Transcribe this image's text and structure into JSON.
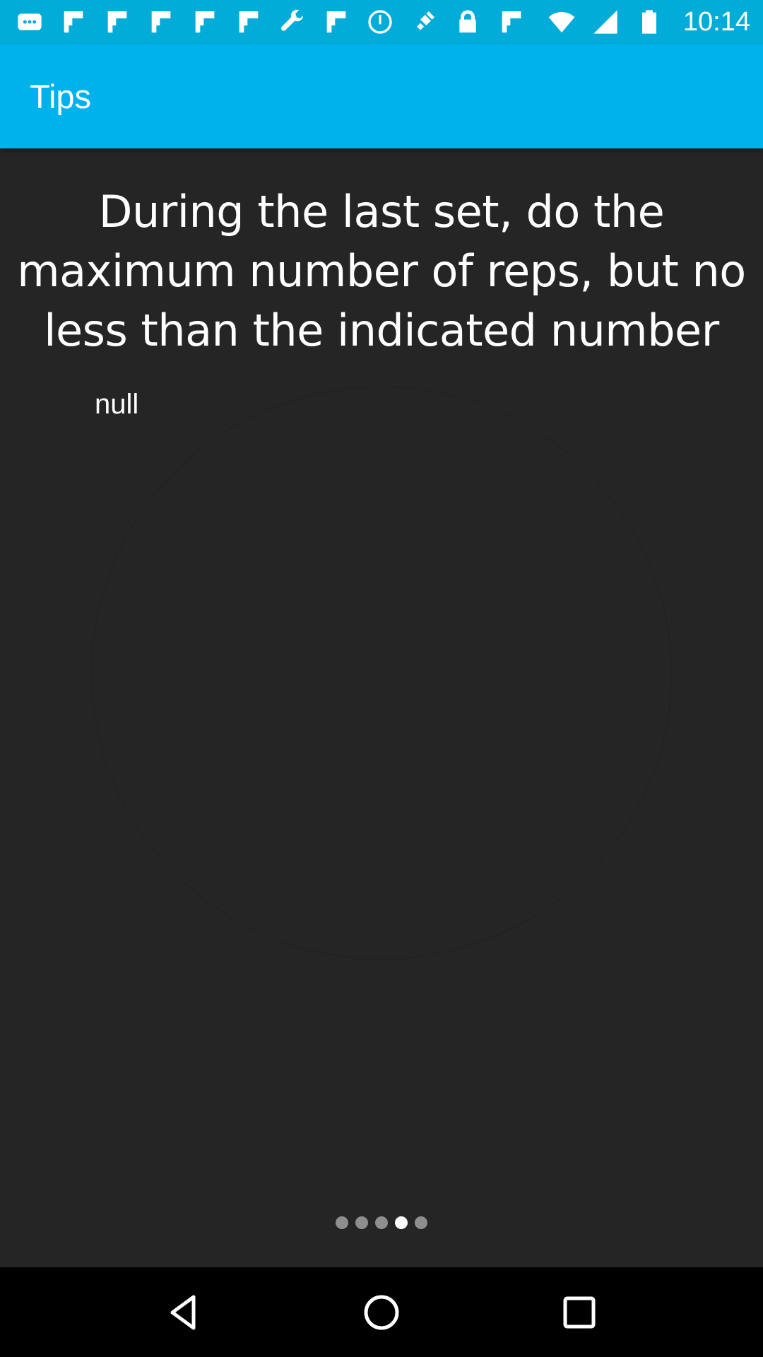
{
  "status_bar": {
    "time": "10:14",
    "icons_left": [
      "messages-icon",
      "flipboard-icon",
      "flipboard-icon",
      "flipboard-icon",
      "flipboard-icon",
      "flipboard-icon",
      "wrench-icon",
      "flipboard-icon",
      "power-save-icon",
      "fake-gps-icon",
      "lock-icon",
      "flipboard-icon"
    ],
    "icons_right": [
      "wifi-icon",
      "signal-icon",
      "battery-icon"
    ]
  },
  "app_bar": {
    "title": "Tips"
  },
  "tip": {
    "text": "During the last set, do the maximum number of reps, but no less than the indicated number",
    "image_label": "null"
  },
  "pager": {
    "count": 5,
    "active_index": 3
  },
  "nav_bar": {
    "buttons": [
      "back-icon",
      "home-icon",
      "recents-icon"
    ]
  },
  "colors": {
    "app_bar": "#00b2ec",
    "background": "#252525",
    "nav_bar": "#000000"
  }
}
